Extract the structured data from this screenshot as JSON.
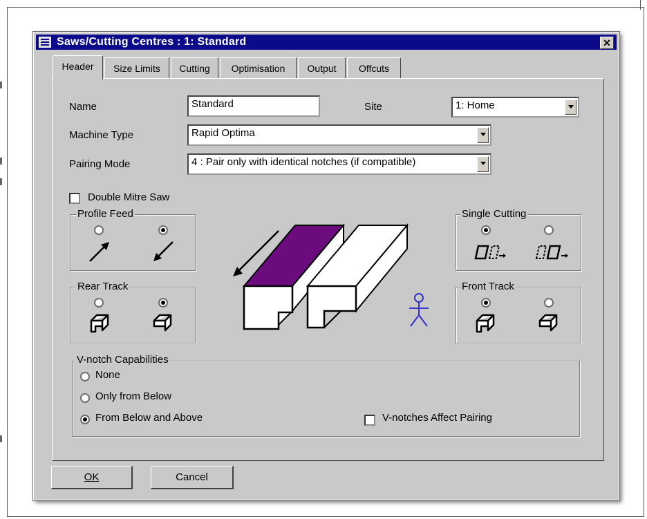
{
  "window": {
    "title": "Saws/Cutting Centres : 1:  Standard"
  },
  "tabs": [
    {
      "label": "Header",
      "active": true
    },
    {
      "label": "Size Limits"
    },
    {
      "label": "Cutting"
    },
    {
      "label": "Optimisation"
    },
    {
      "label": "Output"
    },
    {
      "label": "Offcuts"
    }
  ],
  "header": {
    "name_label": "Name",
    "name_value": "Standard",
    "site_label": "Site",
    "site_value": "1: Home",
    "machine_type_label": "Machine Type",
    "machine_type_value": "Rapid Optima",
    "pairing_mode_label": "Pairing Mode",
    "pairing_mode_value": "4  : Pair only with identical notches (if compatible)",
    "double_mitre_label": "Double Mitre Saw",
    "double_mitre_checked": false
  },
  "profile_feed": {
    "label": "Profile Feed",
    "selected": 2
  },
  "rear_track": {
    "label": "Rear Track",
    "selected": 2
  },
  "single_cutting": {
    "label": "Single Cutting",
    "selected": 1
  },
  "front_track": {
    "label": "Front Track",
    "selected": 1
  },
  "vnotch": {
    "label": "V-notch Capabilities",
    "options": [
      "None",
      "Only from Below",
      "From Below and Above"
    ],
    "selected": 3,
    "affect_pairing_label": "V-notches Affect Pairing",
    "affect_pairing_checked": false
  },
  "buttons": {
    "ok": "OK",
    "cancel": "Cancel"
  },
  "colors": {
    "titlebar": "#0a0a8a",
    "profile_fill": "#6b0b7e",
    "operator": "#3333cc"
  }
}
